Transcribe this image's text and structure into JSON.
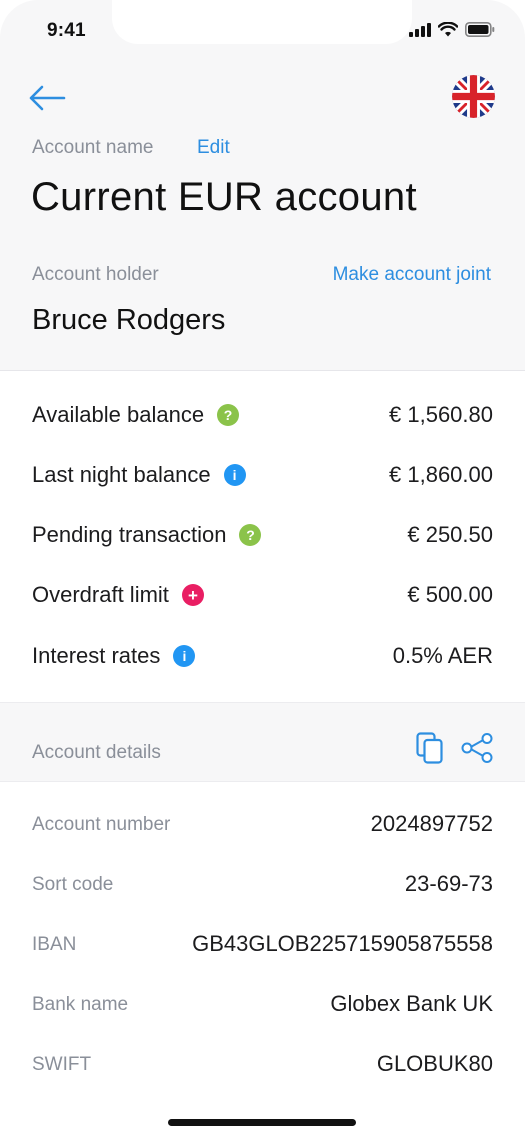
{
  "status_bar": {
    "time": "9:41"
  },
  "header": {
    "account_name_label": "Account name",
    "edit_label": "Edit",
    "account_title": "Current EUR account",
    "holder_label": "Account holder",
    "make_joint_label": "Make account joint",
    "holder_name": "Bruce Rodgers"
  },
  "balances": [
    {
      "label": "Available balance",
      "icon": "question-icon",
      "icon_color": "#8bc34a",
      "glyph": "?",
      "value": "€ 1,560.80"
    },
    {
      "label": "Last night balance",
      "icon": "info-icon",
      "icon_color": "#2196f3",
      "glyph": "i",
      "value": "€ 1,860.00"
    },
    {
      "label": "Pending transaction",
      "icon": "question-icon",
      "icon_color": "#8bc34a",
      "glyph": "?",
      "value": "€ 250.50"
    },
    {
      "label": "Overdraft limit",
      "icon": "plus-icon",
      "icon_color": "#e91e63",
      "glyph": "+",
      "value": "€ 500.00"
    },
    {
      "label": "Interest rates",
      "icon": "info-icon",
      "icon_color": "#2196f3",
      "glyph": "i",
      "value": "0.5% AER"
    }
  ],
  "details_section": {
    "title": "Account details",
    "rows": [
      {
        "label": "Account number",
        "value": "2024897752"
      },
      {
        "label": "Sort code",
        "value": "23-69-73"
      },
      {
        "label": "IBAN",
        "value": "GB43GLOB225715905875558"
      },
      {
        "label": "Bank name",
        "value": "Globex Bank UK"
      },
      {
        "label": "SWIFT",
        "value": "GLOBUK80"
      }
    ]
  },
  "colors": {
    "accent": "#2d8ee0",
    "muted_text": "#8a8f99",
    "panel_bg": "#f7f7f8"
  }
}
